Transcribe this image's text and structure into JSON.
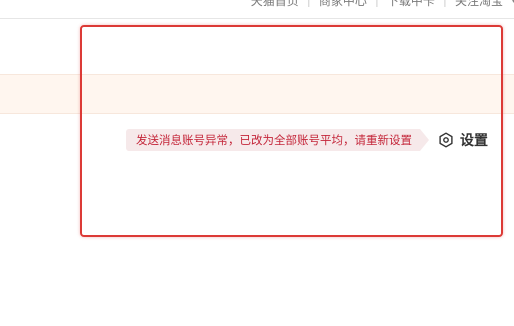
{
  "topnav": {
    "links": [
      "天猫首页",
      "商家中心",
      "下载中卡",
      "关注淘宝"
    ]
  },
  "warning": {
    "message": "发送消息账号异常，已改为全部账号平均，请重新设置"
  },
  "settings": {
    "label": "设置",
    "icon": "settings-icon"
  },
  "colors": {
    "highlight": "#dc3a36",
    "warning_text": "#c4263a",
    "warning_bg": "#f6e9ea",
    "notice_bg": "#fff6ef"
  }
}
